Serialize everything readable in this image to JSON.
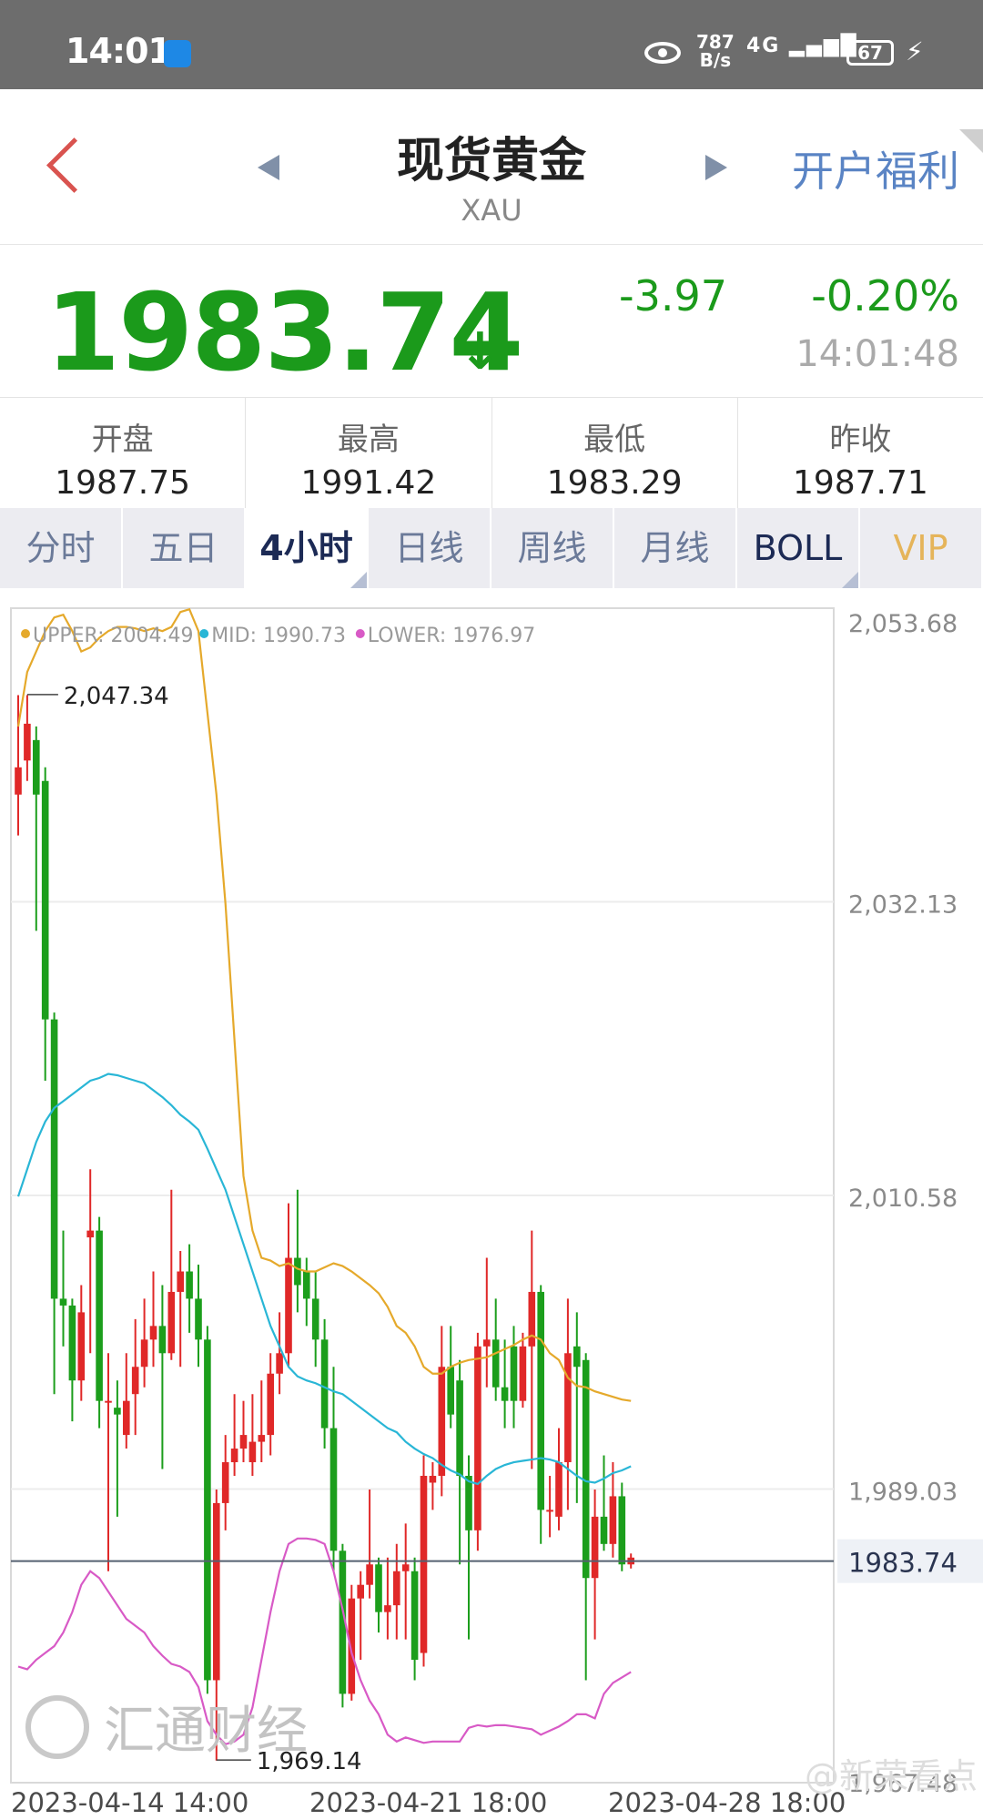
{
  "status_bar": {
    "time": "14:01",
    "speed_value": "787",
    "speed_unit": "B/s",
    "network": "4G",
    "battery": "67"
  },
  "header": {
    "title": "现货黄金",
    "symbol": "XAU",
    "promo": "开户福利"
  },
  "quote": {
    "price": "1983.74",
    "change": "-3.97",
    "change_pct": "-0.20%",
    "time": "14:01:48",
    "color_down": "#1b9a1b"
  },
  "stats": [
    {
      "label": "开盘",
      "value": "1987.75"
    },
    {
      "label": "最高",
      "value": "1991.42"
    },
    {
      "label": "最低",
      "value": "1983.29"
    },
    {
      "label": "昨收",
      "value": "1987.71"
    }
  ],
  "tabs": [
    {
      "label": "分时",
      "active": false
    },
    {
      "label": "五日",
      "active": false
    },
    {
      "label": "4小时",
      "active": true
    },
    {
      "label": "日线",
      "active": false
    },
    {
      "label": "周线",
      "active": false
    },
    {
      "label": "月线",
      "active": false
    },
    {
      "label": "BOLL",
      "active": false
    },
    {
      "label": "VIP",
      "active": false
    }
  ],
  "watermark": "汇通财经",
  "credit": "@新荣看点",
  "chart_data": {
    "type": "candlestick",
    "indicator_legend": [
      {
        "label": "UPPER: 2004.49",
        "color": "#e5a92b"
      },
      {
        "label": "MID: 1990.73",
        "color": "#29b6d6"
      },
      {
        "label": "LOWER: 1976.97",
        "color": "#d85ac6"
      }
    ],
    "y_ticks": [
      "2,053.68",
      "2,032.13",
      "2,010.58",
      "1,989.03",
      "1,967.48"
    ],
    "ylim": [
      1967.48,
      2053.68
    ],
    "x_ticks": [
      "2023-04-14 14:00",
      "2023-04-21 18:00",
      "2023-04-28 18:00"
    ],
    "last_price": 1983.74,
    "last_price_label": "1983.74",
    "max_label": "2,047.34",
    "min_label": "1,969.14",
    "max_value": 2047.34,
    "min_value": 1969.14,
    "candles": [
      [
        2040.0,
        2042.0,
        2047.3,
        2037.0
      ],
      [
        2042.5,
        2045.2,
        2047.3,
        2041.0
      ],
      [
        2044.0,
        2040.0,
        2045.0,
        2030.0
      ],
      [
        2041.0,
        2023.5,
        2042.0,
        2019.0
      ],
      [
        2023.5,
        2003.0,
        2024.0,
        1996.0
      ],
      [
        2003.0,
        2002.5,
        2008.0,
        1999.5
      ],
      [
        2002.5,
        1997.0,
        2003.0,
        1994.0
      ],
      [
        1997.0,
        2002.0,
        2004.0,
        1995.5
      ],
      [
        2007.5,
        2008.0,
        2012.5,
        1999.0
      ],
      [
        2008.0,
        1995.5,
        2009.0,
        1993.5
      ],
      [
        1995.5,
        1995.5,
        1999.0,
        1983.0
      ],
      [
        1995.0,
        1994.5,
        1997.0,
        1987.0
      ],
      [
        1993.0,
        1995.5,
        1999.0,
        1992.0
      ],
      [
        1996.0,
        1998.0,
        2001.5,
        1993.0
      ],
      [
        1998.0,
        2000.0,
        2003.0,
        1996.5
      ],
      [
        2000.0,
        2001.0,
        2005.0,
        1998.0
      ],
      [
        2001.0,
        1999.0,
        2004.0,
        1990.5
      ],
      [
        1999.0,
        2003.5,
        2011.0,
        1998.5
      ],
      [
        2003.5,
        2005.0,
        2006.5,
        1998.0
      ],
      [
        2005.0,
        2003.0,
        2007.0,
        2000.5
      ],
      [
        2003.0,
        2000.0,
        2005.5,
        1998.0
      ],
      [
        2000.0,
        1975.0,
        2001.0,
        1974.0
      ],
      [
        1975.0,
        1988.0,
        1989.0,
        1969.1
      ],
      [
        1988.0,
        1991.0,
        1993.0,
        1986.0
      ],
      [
        1991.0,
        1992.0,
        1996.0,
        1990.0
      ],
      [
        1992.0,
        1993.0,
        1995.5,
        1991.0
      ],
      [
        1991.0,
        1992.5,
        1996.0,
        1990.0
      ],
      [
        1992.5,
        1993.0,
        1997.0,
        1991.0
      ],
      [
        1993.0,
        1997.5,
        1999.0,
        1991.5
      ],
      [
        1997.5,
        1999.0,
        2002.0,
        1996.0
      ],
      [
        1999.0,
        2006.0,
        2010.0,
        1998.0
      ],
      [
        2006.0,
        2004.0,
        2011.0,
        2002.0
      ],
      [
        2005.0,
        2003.0,
        2006.0,
        2001.0
      ],
      [
        2003.0,
        2000.0,
        2005.0,
        1998.0
      ],
      [
        2000.0,
        1993.5,
        2001.5,
        1992.0
      ],
      [
        1993.5,
        1984.5,
        1998.0,
        1983.0
      ],
      [
        1984.5,
        1974.0,
        1985.0,
        1973.0
      ],
      [
        1974.0,
        1981.0,
        1982.0,
        1973.5
      ],
      [
        1981.0,
        1982.0,
        1983.0,
        1976.5
      ],
      [
        1982.0,
        1983.5,
        1989.0,
        1981.0
      ],
      [
        1983.5,
        1980.0,
        1984.0,
        1978.5
      ],
      [
        1980.0,
        1980.5,
        1984.0,
        1978.0
      ],
      [
        1980.5,
        1983.0,
        1985.0,
        1978.0
      ],
      [
        1983.0,
        1983.5,
        1986.5,
        1978.0
      ],
      [
        1983.0,
        1976.5,
        1984.0,
        1975.0
      ],
      [
        1977.0,
        1990.0,
        1991.5,
        1976.0
      ],
      [
        1989.5,
        1990.0,
        1991.0,
        1987.5
      ],
      [
        1990.0,
        1998.0,
        2001.0,
        1988.5
      ],
      [
        1998.0,
        1994.5,
        2001.0,
        1993.5
      ],
      [
        1997.0,
        1990.0,
        1998.5,
        1983.5
      ],
      [
        1990.0,
        1986.0,
        1991.5,
        1978.0
      ],
      [
        1986.0,
        1999.5,
        2000.5,
        1984.5
      ],
      [
        1999.5,
        2000.0,
        2006.0,
        1996.5
      ],
      [
        2000.0,
        1996.5,
        2003.0,
        1995.5
      ],
      [
        1996.5,
        1995.5,
        2000.0,
        1993.5
      ],
      [
        1999.5,
        1995.5,
        2001.0,
        1993.5
      ],
      [
        1995.5,
        1999.5,
        2000.5,
        1995.0
      ],
      [
        1999.5,
        2003.5,
        2008.0,
        1990.5
      ],
      [
        2003.5,
        1987.5,
        2004.0,
        1985.0
      ],
      [
        1987.5,
        1987.5,
        1990.0,
        1985.5
      ],
      [
        1987.0,
        1991.0,
        1993.5,
        1986.0
      ],
      [
        1991.0,
        1999.0,
        2003.0,
        1987.5
      ],
      [
        1999.5,
        1998.0,
        2002.0,
        1988.0
      ],
      [
        1998.5,
        1982.5,
        1999.0,
        1975.0
      ],
      [
        1982.5,
        1987.0,
        1989.0,
        1978.0
      ],
      [
        1987.0,
        1985.0,
        1991.5,
        1984.5
      ],
      [
        1985.0,
        1988.5,
        1991.0,
        1984.0
      ],
      [
        1988.5,
        1983.5,
        1989.5,
        1983.0
      ],
      [
        1983.5,
        1984.0,
        1984.3,
        1983.2
      ]
    ],
    "upper": [
      2045.0,
      2049.0,
      2050.5,
      2052.0,
      2053.0,
      2053.2,
      2052.0,
      2050.5,
      2050.8,
      2051.5,
      2052.0,
      2052.3,
      2052.3,
      2052.2,
      2052.0,
      2052.2,
      2052.0,
      2052.3,
      2053.4,
      2053.6,
      2052.0,
      2046.0,
      2040.0,
      2032.0,
      2022.0,
      2012.0,
      2008.0,
      2006.0,
      2005.8,
      2005.4,
      2005.6,
      2005.2,
      2005.0,
      2005.0,
      2005.3,
      2005.6,
      2005.4,
      2005.0,
      2004.5,
      2004.0,
      2003.4,
      2002.4,
      2001.0,
      2000.5,
      1999.5,
      1998.0,
      1997.5,
      1997.5,
      1998.0,
      1998.3,
      1998.5,
      1998.6,
      1998.7,
      1999.0,
      1999.3,
      1999.6,
      2000.0,
      2000.3,
      2000.0,
      1999.0,
      1998.5,
      1997.2,
      1996.6,
      1996.5,
      1996.2,
      1996.0,
      1995.8,
      1995.6,
      1995.5
    ],
    "mid": [
      2010.5,
      2012.5,
      2014.5,
      2016.0,
      2017.0,
      2017.5,
      2018.0,
      2018.5,
      2019.0,
      2019.2,
      2019.5,
      2019.4,
      2019.2,
      2019.0,
      2018.8,
      2018.3,
      2017.8,
      2017.2,
      2016.5,
      2016.0,
      2015.4,
      2014.0,
      2012.5,
      2011.0,
      2009.0,
      2007.0,
      2005.0,
      2003.0,
      2001.0,
      1999.5,
      1998.0,
      1997.3,
      1997.0,
      1996.8,
      1996.5,
      1996.2,
      1996.0,
      1995.5,
      1995.0,
      1994.5,
      1994.0,
      1993.5,
      1993.2,
      1992.5,
      1992.0,
      1991.6,
      1991.3,
      1990.8,
      1990.4,
      1990.1,
      1989.6,
      1989.4,
      1990.0,
      1990.5,
      1990.8,
      1991.0,
      1991.1,
      1991.2,
      1991.3,
      1991.2,
      1991.0,
      1990.5,
      1990.0,
      1989.6,
      1989.5,
      1989.8,
      1990.2,
      1990.4,
      1990.7
    ],
    "lower": [
      1976.0,
      1975.8,
      1976.5,
      1977.0,
      1977.5,
      1978.5,
      1980.0,
      1982.0,
      1983.0,
      1982.5,
      1981.5,
      1980.5,
      1979.5,
      1979.0,
      1978.5,
      1977.5,
      1976.8,
      1976.2,
      1976.0,
      1975.6,
      1974.5,
      1972.0,
      1971.0,
      1970.3,
      1970.5,
      1971.0,
      1973.0,
      1976.5,
      1980.0,
      1983.0,
      1985.0,
      1985.4,
      1985.4,
      1985.3,
      1985.0,
      1983.0,
      1980.2,
      1977.0,
      1975.0,
      1973.5,
      1972.5,
      1971.0,
      1970.5,
      1970.8,
      1970.6,
      1970.4,
      1970.5,
      1970.5,
      1970.5,
      1970.5,
      1971.5,
      1971.7,
      1971.6,
      1971.7,
      1971.7,
      1971.6,
      1971.5,
      1971.4,
      1971.0,
      1971.3,
      1971.6,
      1972.0,
      1972.5,
      1972.5,
      1972.2,
      1974.0,
      1974.8,
      1975.2,
      1975.6
    ]
  }
}
